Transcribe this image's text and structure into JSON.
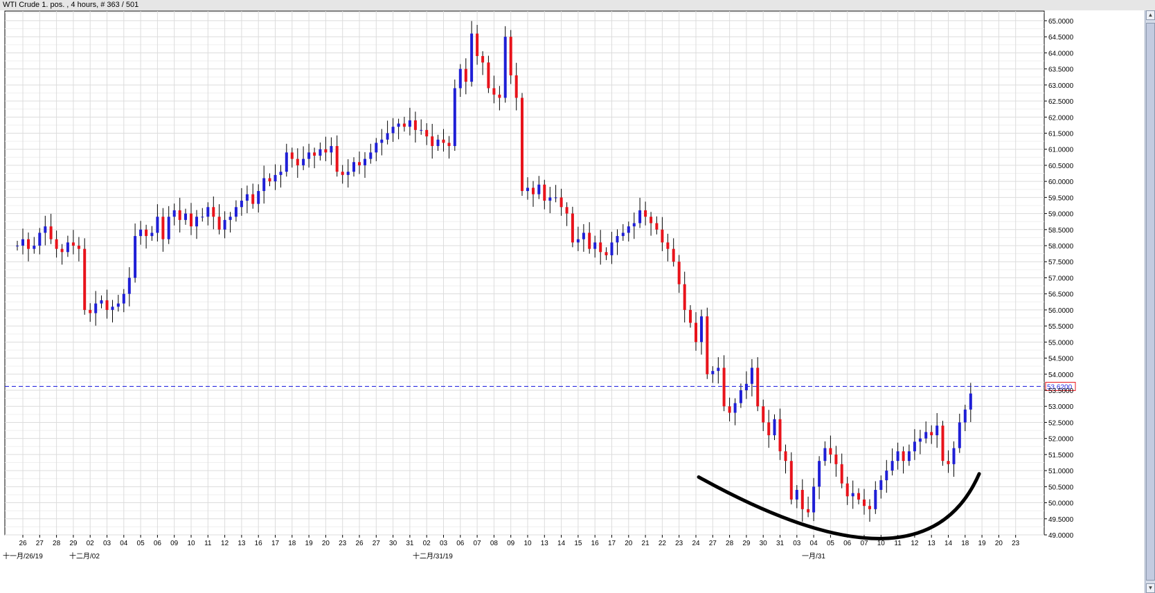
{
  "window": {
    "title": "WTI Crude 1. pos. , 4 hours, # 363 / 501"
  },
  "colors": {
    "up_candle": "#1f1fd6",
    "down_candle": "#e8131b",
    "wick": "#000000",
    "grid": "#dcdcdc",
    "current_line": "#2a2ae0",
    "price_box_border": "#e8131b",
    "price_box_text": "#2a2ae0",
    "annotation_curve": "#000000"
  },
  "icons": {
    "scroll_up": "arrow-up-icon",
    "scroll_down": "arrow-down-icon"
  },
  "chart_data": {
    "type": "candlestick",
    "title": "WTI Crude 1. pos. , 4 hours, # 363 / 501",
    "timeframe": "4 hours",
    "y_axis_side": "right",
    "ylim": [
      49.0,
      65.3
    ],
    "y_ticks": [
      "49.0000",
      "49.5000",
      "50.0000",
      "50.5000",
      "51.0000",
      "51.5000",
      "52.0000",
      "52.5000",
      "53.0000",
      "53.5000",
      "54.0000",
      "54.5000",
      "55.0000",
      "55.5000",
      "56.0000",
      "56.5000",
      "57.0000",
      "57.5000",
      "58.0000",
      "58.5000",
      "59.0000",
      "59.5000",
      "60.0000",
      "60.5000",
      "61.0000",
      "61.5000",
      "62.0000",
      "62.5000",
      "63.0000",
      "63.5000",
      "64.0000",
      "64.5000",
      "65.0000"
    ],
    "x_day_labels": [
      "26",
      "27",
      "28",
      "29",
      "02",
      "03",
      "04",
      "05",
      "06",
      "09",
      "10",
      "11",
      "12",
      "13",
      "16",
      "17",
      "18",
      "19",
      "20",
      "23",
      "26",
      "27",
      "30",
      "31",
      "02",
      "03",
      "06",
      "07",
      "08",
      "09",
      "10",
      "13",
      "14",
      "15",
      "16",
      "17",
      "20",
      "21",
      "22",
      "23",
      "24",
      "27",
      "28",
      "29",
      "30",
      "31",
      "03",
      "04",
      "05",
      "06",
      "07",
      "10",
      "11",
      "12",
      "13",
      "14",
      "18",
      "19",
      "20",
      "23"
    ],
    "x_month_labels": [
      "十一月/26/19",
      "十二月/02",
      "十二月/31/19",
      "一月/31"
    ],
    "current_price": 53.62,
    "current_price_label": "53.6200",
    "grid": true,
    "day_closes": [
      [
        58.0,
        58.2,
        57.9
      ],
      [
        58.0,
        58.4,
        58.6
      ],
      [
        58.2,
        57.9,
        57.8
      ],
      [
        58.1,
        58.0,
        57.9
      ],
      [
        56.0,
        55.9,
        56.2
      ],
      [
        56.3,
        56.0,
        56.1
      ],
      [
        56.2,
        56.5,
        57.0
      ],
      [
        58.3,
        58.5,
        58.3
      ],
      [
        58.4,
        58.9,
        58.2
      ],
      [
        58.9,
        59.1,
        58.8
      ],
      [
        59.0,
        58.6,
        58.9
      ],
      [
        58.9,
        59.2,
        58.9
      ],
      [
        58.5,
        58.8,
        58.9
      ],
      [
        59.2,
        59.4,
        59.6
      ],
      [
        59.3,
        59.7,
        60.1
      ],
      [
        60.0,
        60.2,
        60.3
      ],
      [
        60.9,
        60.7,
        60.5
      ],
      [
        60.7,
        60.9,
        60.8
      ],
      [
        61.0,
        60.9,
        61.1
      ],
      [
        60.3,
        60.2,
        60.3
      ],
      [
        60.6,
        60.5,
        60.7
      ],
      [
        60.9,
        61.2,
        61.3
      ],
      [
        61.5,
        61.7,
        61.8
      ],
      [
        61.7,
        61.9,
        61.6
      ],
      [
        61.6,
        61.4,
        61.1
      ],
      [
        61.3,
        61.2,
        61.1
      ],
      [
        62.9,
        63.5,
        63.1
      ],
      [
        64.6,
        63.9,
        63.7
      ],
      [
        62.9,
        62.7,
        62.6
      ],
      [
        64.5,
        63.3,
        62.6
      ],
      [
        59.7,
        59.8,
        59.6
      ],
      [
        59.9,
        59.4,
        59.5
      ],
      [
        59.5,
        59.2,
        59.0
      ],
      [
        58.1,
        58.2,
        58.4
      ],
      [
        57.9,
        58.1,
        57.8
      ],
      [
        57.7,
        58.1,
        58.3
      ],
      [
        58.4,
        58.6,
        58.7
      ],
      [
        59.1,
        58.9,
        58.7
      ],
      [
        58.5,
        58.1,
        57.9
      ],
      [
        57.5,
        56.8,
        56.0
      ],
      [
        55.6,
        55.0,
        55.8
      ],
      [
        54.0,
        54.1,
        54.2
      ],
      [
        53.0,
        52.8,
        53.1
      ],
      [
        53.5,
        53.7,
        54.2
      ],
      [
        53.0,
        52.5,
        52.1
      ],
      [
        52.6,
        51.6,
        51.3
      ],
      [
        50.1,
        50.4,
        49.8
      ],
      [
        49.7,
        50.5,
        51.3
      ],
      [
        51.7,
        51.5,
        51.2
      ],
      [
        50.6,
        50.2,
        50.3
      ],
      [
        50.1,
        49.9,
        49.8
      ],
      [
        50.4,
        50.7,
        51.0
      ],
      [
        51.3,
        51.6,
        51.3
      ],
      [
        51.6,
        51.9,
        52.0
      ],
      [
        52.2,
        52.1,
        52.4
      ],
      [
        51.3,
        51.2,
        51.7
      ],
      [
        52.5,
        52.9,
        53.4
      ]
    ],
    "annotation": {
      "type": "curve",
      "description": "rounded bottom",
      "points": [
        [
          "24",
          50.8
        ],
        [
          "10",
          49.1
        ],
        [
          "19",
          50.9
        ]
      ]
    }
  }
}
